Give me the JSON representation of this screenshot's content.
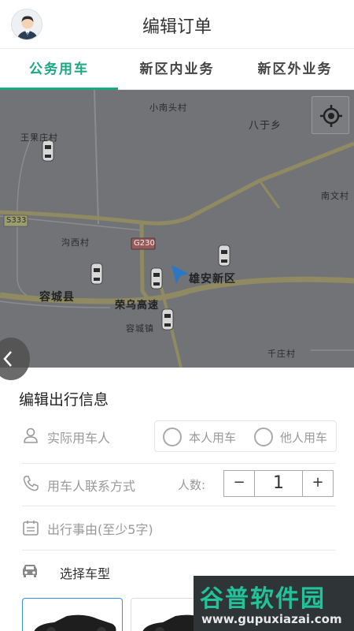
{
  "header": {
    "title": "编辑订单"
  },
  "tabs": [
    {
      "label": "公务用车",
      "active": true
    },
    {
      "label": "新区内业务",
      "active": false
    },
    {
      "label": "新区外业务",
      "active": false
    }
  ],
  "map": {
    "labels": {
      "village1": "小南头村",
      "village2": "八于乡",
      "village3": "王果庄村",
      "village4": "南文村",
      "road_s333": "S333",
      "village5": "沟西村",
      "road_g230": "G230",
      "district": "雄安新区",
      "county": "容城县",
      "highway": "荣乌高速",
      "town": "容城镇",
      "village6": "千庄村"
    }
  },
  "form": {
    "section_title": "编辑出行信息",
    "passenger_placeholder": "实际用车人",
    "radio_self": "本人用车",
    "radio_other": "他人用车",
    "contact_placeholder": "用车人联系方式",
    "count_label": "人数:",
    "count_value": "1",
    "minus": "−",
    "plus": "+",
    "reason_placeholder": "出行事由(至少5字)",
    "car_type_label": "选择车型"
  },
  "watermark": {
    "title": "谷普软件园",
    "url": "www.gupuxiazai.com"
  },
  "colors": {
    "accent": "#19a882",
    "selected_border": "#3a8ee6"
  }
}
